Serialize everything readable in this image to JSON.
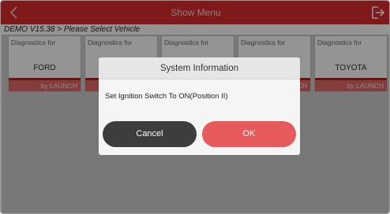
{
  "header": {
    "title": "Show Menu",
    "back_icon": "chevron-left-icon",
    "exit_icon": "exit-icon",
    "accent_color": "#dc2d2d"
  },
  "breadcrumb": "DEMO V15.38 > Please Select Vehicle",
  "cards": [
    {
      "caption": "Diagnostics for",
      "brand": "FORD",
      "footer": "by LAUNCH"
    },
    {
      "caption": "Diagnostics for",
      "brand": "",
      "footer": ""
    },
    {
      "caption": "Diagnostics for",
      "brand": "",
      "footer": ""
    },
    {
      "caption": "Diagnostics for",
      "brand": "",
      "footer": "CH"
    },
    {
      "caption": "Diagnostics for",
      "brand": "TOYOTA",
      "footer": "by LAUNCH"
    }
  ],
  "dialog": {
    "title": "System Information",
    "message": "Set Ignition Switch To ON(Position II)",
    "cancel_label": "Cancel",
    "ok_label": "OK",
    "cancel_color": "#3d3d3d",
    "ok_color": "#e75a5c"
  }
}
